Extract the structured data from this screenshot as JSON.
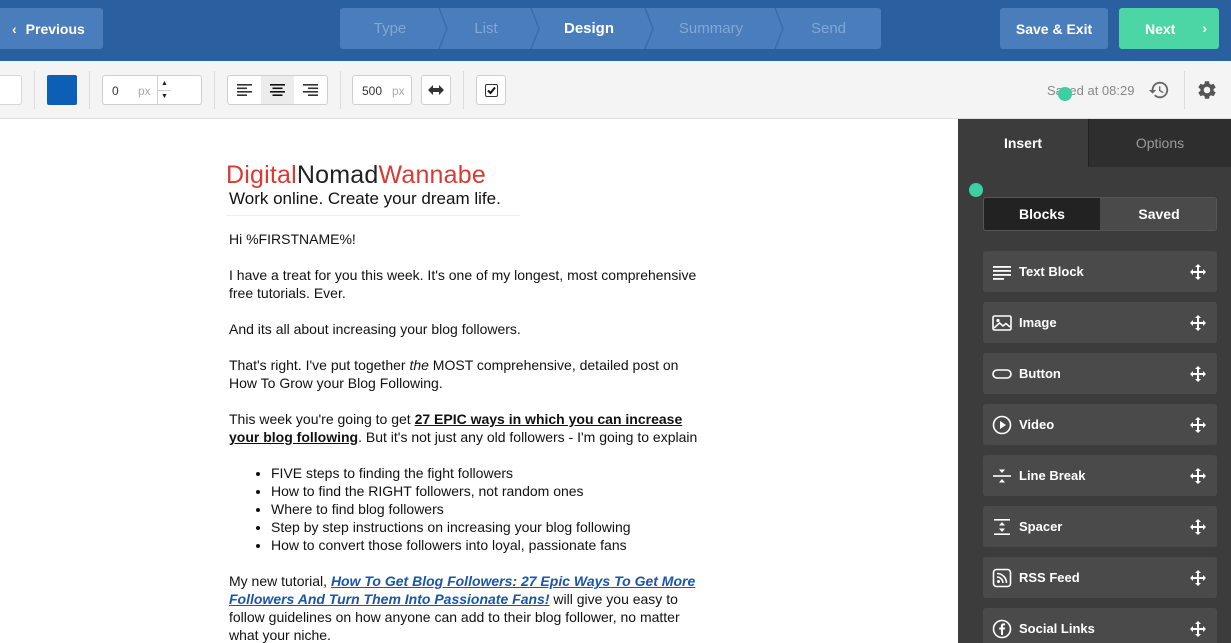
{
  "topbar": {
    "previous_label": "Previous",
    "steps": [
      "Type",
      "List",
      "Design",
      "Summary",
      "Send"
    ],
    "active_step": "Design",
    "save_exit_label": "Save & Exit",
    "next_label": "Next"
  },
  "toolbar": {
    "color_value": "#0c5fb5",
    "padding_value": "0",
    "padding_unit": "px",
    "width_value": "500",
    "width_unit": "px",
    "saved_status": "Saved at 08:29"
  },
  "email": {
    "logo_part1": "Digital",
    "logo_part2": "Nomad",
    "logo_part3": "Wannabe",
    "tagline": "Work online. Create your dream life.",
    "greeting": "Hi %FIRSTNAME%!",
    "p1": "I have a treat for you this week.  It's one of my longest, most comprehensive free tutorials.  Ever.",
    "p2": "And its all about increasing your blog followers.",
    "p3_a": "That's right.  I've put together ",
    "p3_b": "the",
    "p3_c": " MOST comprehensive, detailed post on How To Grow your Blog Following.",
    "p4_a": "This week you're going to get ",
    "p4_bold": "27 EPIC ways in which you can increase your blog following",
    "p4_b": ". But it's not just any old followers - I'm going to explain",
    "bullets": [
      "FIVE steps to finding the fight followers",
      "How to find the RIGHT followers, not random ones",
      "Where to find blog followers",
      "Step by step instructions on increasing your blog following",
      "How to convert those followers into loyal, passionate fans"
    ],
    "p5_a": "My new tutorial, ",
    "p5_link": "How To Get Blog Followers: 27 Epic Ways To Get More Followers And Turn Them Into Passionate Fans!",
    "p5_b": " will give you easy to follow guidelines on how anyone can add to their blog follower, no matter what your niche."
  },
  "sidebar": {
    "tab_insert": "Insert",
    "tab_options": "Options",
    "seg_blocks": "Blocks",
    "seg_saved": "Saved",
    "blocks": [
      {
        "label": "Text Block",
        "icon": "text-lines-icon"
      },
      {
        "label": "Image",
        "icon": "image-icon"
      },
      {
        "label": "Button",
        "icon": "button-pill-icon"
      },
      {
        "label": "Video",
        "icon": "play-circle-icon"
      },
      {
        "label": "Line Break",
        "icon": "line-break-icon"
      },
      {
        "label": "Spacer",
        "icon": "spacer-icon"
      },
      {
        "label": "RSS Feed",
        "icon": "rss-icon"
      },
      {
        "label": "Social Links",
        "icon": "facebook-circle-icon"
      }
    ]
  },
  "colors": {
    "topbar_bg": "#2a5fa0",
    "step_bg": "#4a7dbb",
    "next_green": "#4dd6a5",
    "logo_red": "#d93b32",
    "link_blue": "#1a56a8",
    "sidebar_bg": "#3c3c3c"
  }
}
